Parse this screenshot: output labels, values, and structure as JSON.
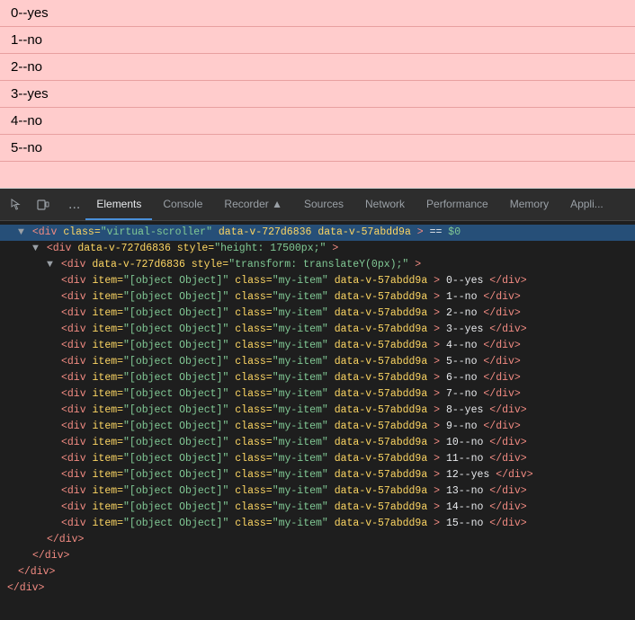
{
  "preview": {
    "items": [
      {
        "label": "0--yes",
        "highlight": false
      },
      {
        "label": "1--no",
        "highlight": false
      },
      {
        "label": "2--no",
        "highlight": false
      },
      {
        "label": "3--yes",
        "highlight": false
      },
      {
        "label": "4--no",
        "highlight": false
      },
      {
        "label": "5--no",
        "highlight": false
      }
    ]
  },
  "devtools": {
    "tabs": [
      {
        "label": "Elements",
        "active": true
      },
      {
        "label": "Console",
        "active": false
      },
      {
        "label": "Recorder ▲",
        "active": false
      },
      {
        "label": "Sources",
        "active": false
      },
      {
        "label": "Network",
        "active": false
      },
      {
        "label": "Performance",
        "active": false
      },
      {
        "label": "Memory",
        "active": false
      },
      {
        "label": "Appli...",
        "active": false
      }
    ],
    "dom": {
      "lines": [
        {
          "indent": 1,
          "content": "▼ <div class=\"virtual-scroller\" data-v-727d6836 data-v-57abdd9a> == $0",
          "selected": true
        },
        {
          "indent": 2,
          "content": "▼ <div data-v-727d6836 style=\"height: 17500px;\">"
        },
        {
          "indent": 3,
          "content": "▼ <div data-v-727d6836 style=\"transform: translateY(0px);\">"
        },
        {
          "indent": 4,
          "content": "<div item=\"[object Object]\" class=\"my-item\" data-v-57abdd9a>0--yes</div>"
        },
        {
          "indent": 4,
          "content": "<div item=\"[object Object]\" class=\"my-item\" data-v-57abdd9a>1--no</div>"
        },
        {
          "indent": 4,
          "content": "<div item=\"[object Object]\" class=\"my-item\" data-v-57abdd9a>2--no</div>"
        },
        {
          "indent": 4,
          "content": "<div item=\"[object Object]\" class=\"my-item\" data-v-57abdd9a>3--yes</div>"
        },
        {
          "indent": 4,
          "content": "<div item=\"[object Object]\" class=\"my-item\" data-v-57abdd9a>4--no</div>"
        },
        {
          "indent": 4,
          "content": "<div item=\"[object Object]\" class=\"my-item\" data-v-57abdd9a>5--no</div>"
        },
        {
          "indent": 4,
          "content": "<div item=\"[object Object]\" class=\"my-item\" data-v-57abdd9a>6--no</div>"
        },
        {
          "indent": 4,
          "content": "<div item=\"[object Object]\" class=\"my-item\" data-v-57abdd9a>7--no</div>"
        },
        {
          "indent": 4,
          "content": "<div item=\"[object Object]\" class=\"my-item\" data-v-57abdd9a>8--yes</div>"
        },
        {
          "indent": 4,
          "content": "<div item=\"[object Object]\" class=\"my-item\" data-v-57abdd9a>9--no</div>"
        },
        {
          "indent": 4,
          "content": "<div item=\"[object Object]\" class=\"my-item\" data-v-57abdd9a>10--no</div>"
        },
        {
          "indent": 4,
          "content": "<div item=\"[object Object]\" class=\"my-item\" data-v-57abdd9a>11--no</div>"
        },
        {
          "indent": 4,
          "content": "<div item=\"[object Object]\" class=\"my-item\" data-v-57abdd9a>12--yes</div>"
        },
        {
          "indent": 4,
          "content": "<div item=\"[object Object]\" class=\"my-item\" data-v-57abdd9a>13--no</div>"
        },
        {
          "indent": 4,
          "content": "<div item=\"[object Object]\" class=\"my-item\" data-v-57abdd9a>14--no</div>"
        },
        {
          "indent": 4,
          "content": "<div item=\"[object Object]\" class=\"my-item\" data-v-57abdd9a>15--no</div>"
        },
        {
          "indent": 3,
          "content": "</div>"
        },
        {
          "indent": 2,
          "content": "</div>"
        },
        {
          "indent": 1,
          "content": "</div>"
        },
        {
          "indent": 0,
          "content": "</div>"
        }
      ]
    }
  }
}
